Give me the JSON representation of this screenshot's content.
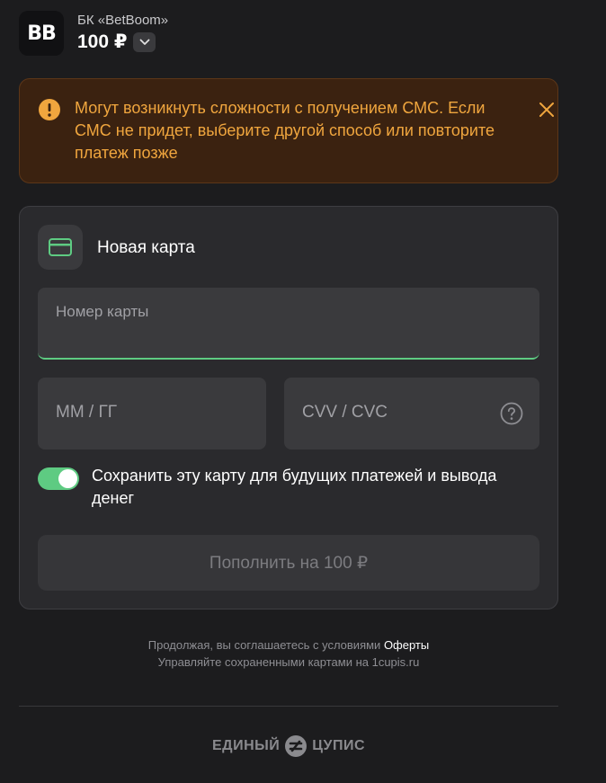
{
  "header": {
    "logo_text": "BB",
    "merchant_name": "БК «BetBoom»",
    "amount": "100 ₽"
  },
  "warning": {
    "message": "Могут возникнуть сложности с получением СМС. Если СМС не придет, выберите другой способ или повторите платеж позже",
    "icon": "warning-circle-icon",
    "close_icon": "close-icon"
  },
  "card_form": {
    "title": "Новая карта",
    "card_number_placeholder": "Номер карты",
    "expiry_placeholder": "ММ / ГГ",
    "cvv_placeholder": "CVV / CVC",
    "save_card_label": "Сохранить эту карту для будущих платежей и вывода денег",
    "save_card_enabled": true,
    "submit_label": "Пополнить на 100 ₽"
  },
  "footer": {
    "terms_prefix": "Продолжая, вы соглашаетесь с условиями",
    "terms_link": "Оферты",
    "manage_text": "Управляйте сохраненными картами на 1cupis.ru",
    "brand_left": "ЕДИНЫЙ",
    "brand_right": "ЦУПИС"
  },
  "colors": {
    "background": "#1c1c1e",
    "accent_green": "#5ecb82",
    "warning_orange": "#f0a63e",
    "warning_bg": "#3b2210"
  }
}
